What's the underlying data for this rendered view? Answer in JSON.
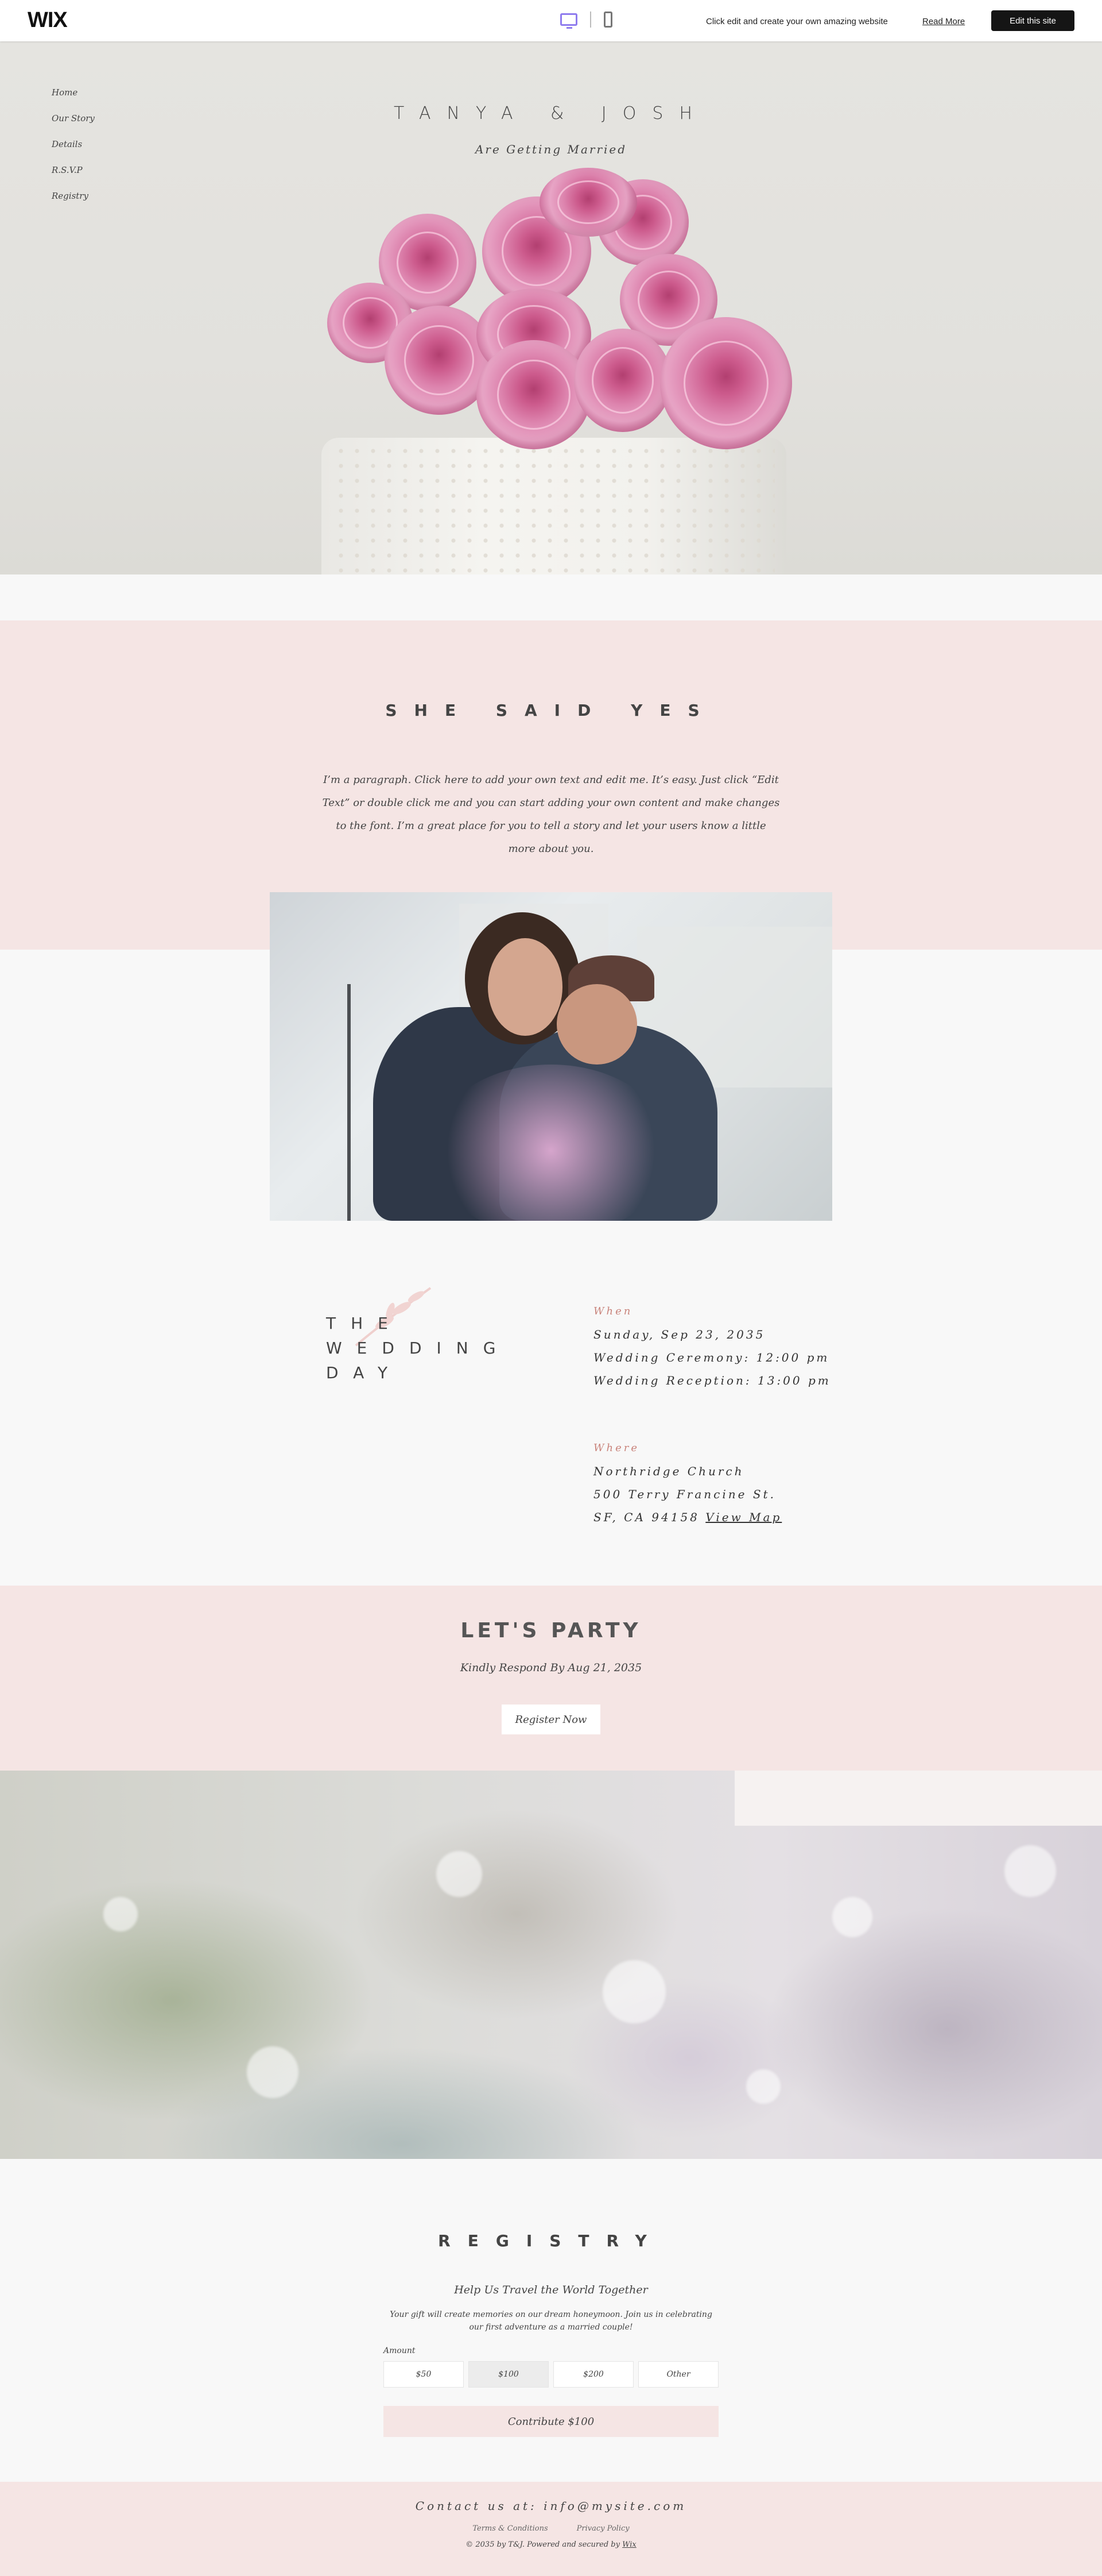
{
  "topbar": {
    "logo": "WIX",
    "promo_text": "Click edit and create your own amazing website",
    "read_more": "Read More",
    "edit_button": "Edit this site"
  },
  "nav": {
    "items": [
      "Home",
      "Our Story",
      "Details",
      "R.S.V.P",
      "Registry"
    ]
  },
  "hero": {
    "title": "TANYA & JOSH",
    "subtitle": "Are Getting Married"
  },
  "story": {
    "title": "SHE SAID YES",
    "paragraph": "I’m a paragraph. Click here to add your own text and edit me. It’s easy. Just click “Edit Text” or double click me and you can start adding your own content and make changes to the font. I’m a great place for you to tell a story and let your users know a little more about you."
  },
  "wedding_day": {
    "title_lines": [
      "THE",
      "WEDDING",
      "DAY"
    ],
    "when_label": "When",
    "when_lines": [
      "Sunday, Sep 23, 2035",
      "Wedding Ceremony: 12:00 pm",
      "Wedding Reception: 13:00 pm"
    ],
    "where_label": "Where",
    "where_lines": [
      "Northridge Church",
      "500 Terry Francine St."
    ],
    "where_city": "SF, CA 94158",
    "view_map": "View Map"
  },
  "party": {
    "title": "LET'S PARTY",
    "subtitle": "Kindly Respond By Aug 21, 2035",
    "button": "Register Now"
  },
  "registry": {
    "title": "REGISTRY",
    "subtitle": "Help Us Travel the World Together",
    "paragraph": "Your gift will create memories on our dream honeymoon. Join us in celebrating our first adventure as a married couple!",
    "amount_label": "Amount",
    "amounts": [
      "$50",
      "$100",
      "$200",
      "Other"
    ],
    "selected_amount": "$100",
    "contribute_button": "Contribute $100"
  },
  "footer": {
    "contact": "Contact us at: info@mysite.com",
    "terms": "Terms & Conditions",
    "privacy": "Privacy Policy",
    "copyright": "© 2035 by T&J. Powered and secured by",
    "wix_link": "Wix"
  },
  "colors": {
    "pink_band": "#f5e5e4",
    "accent_label": "#c9847c",
    "edit_button_bg": "#151515",
    "device_icon_active": "#8f7cee"
  }
}
